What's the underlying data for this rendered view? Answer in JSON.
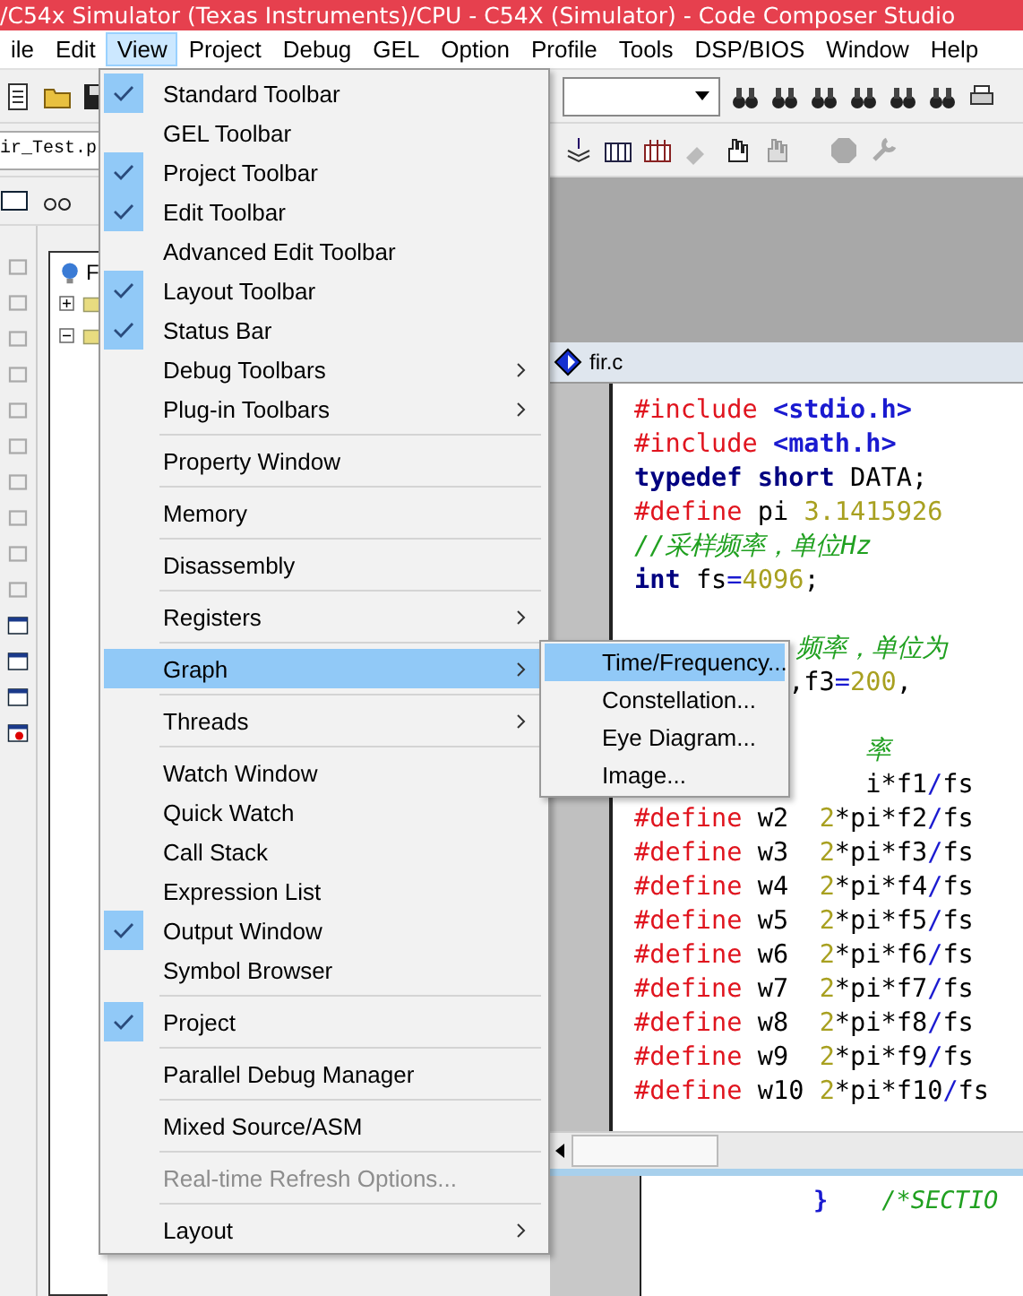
{
  "window": {
    "title": "/C54x Simulator (Texas Instruments)/CPU - C54X (Simulator) - Code Composer Studio"
  },
  "menu_bar": [
    {
      "label": "ile",
      "selected": false
    },
    {
      "label": "Edit",
      "selected": false
    },
    {
      "label": "View",
      "selected": true
    },
    {
      "label": "Project",
      "selected": false
    },
    {
      "label": "Debug",
      "selected": false
    },
    {
      "label": "GEL",
      "selected": false
    },
    {
      "label": "Option",
      "selected": false
    },
    {
      "label": "Profile",
      "selected": false
    },
    {
      "label": "Tools",
      "selected": false
    },
    {
      "label": "DSP/BIOS",
      "selected": false
    },
    {
      "label": "Window",
      "selected": false
    },
    {
      "label": "Help",
      "selected": false
    }
  ],
  "project_field": {
    "value": "ir_Test.p"
  },
  "project_tree": {
    "root_label": "F"
  },
  "view_menu": [
    {
      "kind": "item",
      "label": "Standard Toolbar",
      "checked": true,
      "submenu": false,
      "disabled": false,
      "selected": false
    },
    {
      "kind": "item",
      "label": "GEL Toolbar",
      "checked": false,
      "submenu": false,
      "disabled": false,
      "selected": false
    },
    {
      "kind": "item",
      "label": "Project Toolbar",
      "checked": true,
      "submenu": false,
      "disabled": false,
      "selected": false
    },
    {
      "kind": "item",
      "label": "Edit Toolbar",
      "checked": true,
      "submenu": false,
      "disabled": false,
      "selected": false
    },
    {
      "kind": "item",
      "label": "Advanced Edit Toolbar",
      "checked": false,
      "submenu": false,
      "disabled": false,
      "selected": false
    },
    {
      "kind": "item",
      "label": "Layout Toolbar",
      "checked": true,
      "submenu": false,
      "disabled": false,
      "selected": false
    },
    {
      "kind": "item",
      "label": "Status Bar",
      "checked": true,
      "submenu": false,
      "disabled": false,
      "selected": false
    },
    {
      "kind": "item",
      "label": "Debug Toolbars",
      "checked": false,
      "submenu": true,
      "disabled": false,
      "selected": false
    },
    {
      "kind": "item",
      "label": "Plug-in Toolbars",
      "checked": false,
      "submenu": true,
      "disabled": false,
      "selected": false
    },
    {
      "kind": "separator"
    },
    {
      "kind": "item",
      "label": "Property Window",
      "checked": false,
      "submenu": false,
      "disabled": false,
      "selected": false
    },
    {
      "kind": "separator"
    },
    {
      "kind": "item",
      "label": "Memory",
      "checked": false,
      "submenu": false,
      "disabled": false,
      "selected": false
    },
    {
      "kind": "separator"
    },
    {
      "kind": "item",
      "label": "Disassembly",
      "checked": false,
      "submenu": false,
      "disabled": false,
      "selected": false
    },
    {
      "kind": "separator"
    },
    {
      "kind": "item",
      "label": "Registers",
      "checked": false,
      "submenu": true,
      "disabled": false,
      "selected": false
    },
    {
      "kind": "separator"
    },
    {
      "kind": "item",
      "label": "Graph",
      "checked": false,
      "submenu": true,
      "disabled": false,
      "selected": true
    },
    {
      "kind": "separator"
    },
    {
      "kind": "item",
      "label": "Threads",
      "checked": false,
      "submenu": true,
      "disabled": false,
      "selected": false
    },
    {
      "kind": "separator"
    },
    {
      "kind": "item",
      "label": "Watch Window",
      "checked": false,
      "submenu": false,
      "disabled": false,
      "selected": false
    },
    {
      "kind": "item",
      "label": "Quick Watch",
      "checked": false,
      "submenu": false,
      "disabled": false,
      "selected": false
    },
    {
      "kind": "item",
      "label": "Call Stack",
      "checked": false,
      "submenu": false,
      "disabled": false,
      "selected": false
    },
    {
      "kind": "item",
      "label": "Expression List",
      "checked": false,
      "submenu": false,
      "disabled": false,
      "selected": false
    },
    {
      "kind": "item",
      "label": "Output Window",
      "checked": true,
      "submenu": false,
      "disabled": false,
      "selected": false
    },
    {
      "kind": "item",
      "label": "Symbol Browser",
      "checked": false,
      "submenu": false,
      "disabled": false,
      "selected": false
    },
    {
      "kind": "separator"
    },
    {
      "kind": "item",
      "label": "Project",
      "checked": true,
      "submenu": false,
      "disabled": false,
      "selected": false
    },
    {
      "kind": "separator"
    },
    {
      "kind": "item",
      "label": "Parallel Debug Manager",
      "checked": false,
      "submenu": false,
      "disabled": false,
      "selected": false
    },
    {
      "kind": "separator"
    },
    {
      "kind": "item",
      "label": "Mixed Source/ASM",
      "checked": false,
      "submenu": false,
      "disabled": false,
      "selected": false
    },
    {
      "kind": "separator"
    },
    {
      "kind": "item",
      "label": "Real-time Refresh Options...",
      "checked": false,
      "submenu": false,
      "disabled": true,
      "selected": false
    },
    {
      "kind": "separator"
    },
    {
      "kind": "item",
      "label": "Layout",
      "checked": false,
      "submenu": true,
      "disabled": false,
      "selected": false
    }
  ],
  "graph_submenu": [
    {
      "label": "Time/Frequency...",
      "selected": true
    },
    {
      "label": "Constellation...",
      "selected": false
    },
    {
      "label": "Eye Diagram...",
      "selected": false
    },
    {
      "label": "Image...",
      "selected": false
    }
  ],
  "editor": {
    "tab": "fir.c",
    "lines": [
      {
        "kind": "full",
        "tokens": [
          {
            "kind": "directive",
            "text": "#include "
          },
          {
            "kind": "header",
            "text": "<stdio.h>"
          }
        ]
      },
      {
        "kind": "full",
        "tokens": [
          {
            "kind": "directive",
            "text": "#include "
          },
          {
            "kind": "header",
            "text": "<math.h>"
          }
        ]
      },
      {
        "kind": "full",
        "tokens": [
          {
            "kind": "keyword",
            "text": "typedef short "
          },
          {
            "kind": "plain",
            "text": "DATA;"
          }
        ]
      },
      {
        "kind": "full",
        "tokens": [
          {
            "kind": "directive",
            "text": "#define "
          },
          {
            "kind": "plain",
            "text": "pi "
          },
          {
            "kind": "number",
            "text": "3.1415926"
          }
        ]
      },
      {
        "kind": "full",
        "tokens": [
          {
            "kind": "comment",
            "text": "//采样频率，单位Hz"
          }
        ]
      },
      {
        "kind": "full",
        "tokens": [
          {
            "kind": "keyword",
            "text": "int "
          },
          {
            "kind": "plain",
            "text": "fs"
          },
          {
            "kind": "operator",
            "text": "="
          },
          {
            "kind": "number",
            "text": "4096"
          },
          {
            "kind": "plain",
            "text": ";"
          }
        ]
      },
      {
        "kind": "blank"
      },
      {
        "kind": "partial",
        "tokens": [
          {
            "kind": "comment",
            "text": "频率，单位为"
          }
        ]
      },
      {
        "kind": "partial",
        "tokens": [
          {
            "kind": "plain",
            "text": ",f3"
          },
          {
            "kind": "operator",
            "text": "="
          },
          {
            "kind": "number",
            "text": "200"
          },
          {
            "kind": "plain",
            "text": ","
          }
        ]
      },
      {
        "kind": "blank"
      },
      {
        "kind": "partial",
        "tokens": [
          {
            "kind": "comment",
            "text": "率"
          }
        ]
      },
      {
        "kind": "partial",
        "tokens": [
          {
            "kind": "plain",
            "text": "i*f1"
          },
          {
            "kind": "operator",
            "text": "/"
          },
          {
            "kind": "plain",
            "text": "fs"
          }
        ]
      },
      {
        "kind": "full",
        "tokens": [
          {
            "kind": "directive",
            "text": "#define "
          },
          {
            "kind": "plain",
            "text": "w2  "
          },
          {
            "kind": "number",
            "text": "2"
          },
          {
            "kind": "plain",
            "text": "*pi*f2"
          },
          {
            "kind": "operator",
            "text": "/"
          },
          {
            "kind": "plain",
            "text": "fs"
          }
        ]
      },
      {
        "kind": "full",
        "tokens": [
          {
            "kind": "directive",
            "text": "#define "
          },
          {
            "kind": "plain",
            "text": "w3  "
          },
          {
            "kind": "number",
            "text": "2"
          },
          {
            "kind": "plain",
            "text": "*pi*f3"
          },
          {
            "kind": "operator",
            "text": "/"
          },
          {
            "kind": "plain",
            "text": "fs"
          }
        ]
      },
      {
        "kind": "full",
        "tokens": [
          {
            "kind": "directive",
            "text": "#define "
          },
          {
            "kind": "plain",
            "text": "w4  "
          },
          {
            "kind": "number",
            "text": "2"
          },
          {
            "kind": "plain",
            "text": "*pi*f4"
          },
          {
            "kind": "operator",
            "text": "/"
          },
          {
            "kind": "plain",
            "text": "fs"
          }
        ]
      },
      {
        "kind": "full",
        "tokens": [
          {
            "kind": "directive",
            "text": "#define "
          },
          {
            "kind": "plain",
            "text": "w5  "
          },
          {
            "kind": "number",
            "text": "2"
          },
          {
            "kind": "plain",
            "text": "*pi*f5"
          },
          {
            "kind": "operator",
            "text": "/"
          },
          {
            "kind": "plain",
            "text": "fs"
          }
        ]
      },
      {
        "kind": "full",
        "tokens": [
          {
            "kind": "directive",
            "text": "#define "
          },
          {
            "kind": "plain",
            "text": "w6  "
          },
          {
            "kind": "number",
            "text": "2"
          },
          {
            "kind": "plain",
            "text": "*pi*f6"
          },
          {
            "kind": "operator",
            "text": "/"
          },
          {
            "kind": "plain",
            "text": "fs"
          }
        ]
      },
      {
        "kind": "full",
        "tokens": [
          {
            "kind": "directive",
            "text": "#define "
          },
          {
            "kind": "plain",
            "text": "w7  "
          },
          {
            "kind": "number",
            "text": "2"
          },
          {
            "kind": "plain",
            "text": "*pi*f7"
          },
          {
            "kind": "operator",
            "text": "/"
          },
          {
            "kind": "plain",
            "text": "fs"
          }
        ]
      },
      {
        "kind": "full",
        "tokens": [
          {
            "kind": "directive",
            "text": "#define "
          },
          {
            "kind": "plain",
            "text": "w8  "
          },
          {
            "kind": "number",
            "text": "2"
          },
          {
            "kind": "plain",
            "text": "*pi*f8"
          },
          {
            "kind": "operator",
            "text": "/"
          },
          {
            "kind": "plain",
            "text": "fs"
          }
        ]
      },
      {
        "kind": "full",
        "tokens": [
          {
            "kind": "directive",
            "text": "#define "
          },
          {
            "kind": "plain",
            "text": "w9  "
          },
          {
            "kind": "number",
            "text": "2"
          },
          {
            "kind": "plain",
            "text": "*pi*f9"
          },
          {
            "kind": "operator",
            "text": "/"
          },
          {
            "kind": "plain",
            "text": "fs"
          }
        ]
      },
      {
        "kind": "full",
        "tokens": [
          {
            "kind": "directive",
            "text": "#define "
          },
          {
            "kind": "plain",
            "text": "w10 "
          },
          {
            "kind": "number",
            "text": "2"
          },
          {
            "kind": "plain",
            "text": "*pi*f10"
          },
          {
            "kind": "operator",
            "text": "/"
          },
          {
            "kind": "plain",
            "text": "fs"
          }
        ]
      }
    ]
  },
  "output_pane": {
    "tokens": [
      {
        "kind": "header",
        "text": "}"
      },
      {
        "kind": "comment",
        "text": "/*SECTIO"
      }
    ]
  }
}
